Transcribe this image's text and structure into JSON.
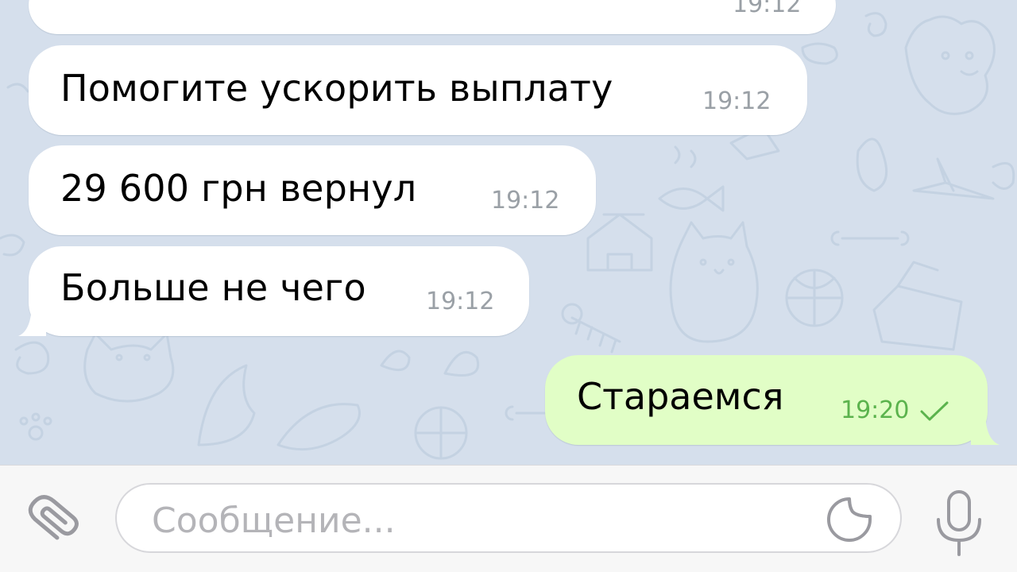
{
  "messages": [
    {
      "direction": "incoming",
      "text": "",
      "time": "19:12"
    },
    {
      "direction": "incoming",
      "text": "Помогите ускорить выплату",
      "time": "19:12"
    },
    {
      "direction": "incoming",
      "text": "29 600 грн вернул",
      "time": "19:12"
    },
    {
      "direction": "incoming",
      "text": "Больше не чего",
      "time": "19:12"
    },
    {
      "direction": "outgoing",
      "text": "Стараемся",
      "time": "19:20",
      "status": "sent-checkmark"
    }
  ],
  "composer": {
    "placeholder": "Сообщение..."
  },
  "icons": {
    "attach": "paperclip-icon",
    "sticker": "sticker-icon",
    "voice": "microphone-icon",
    "sent": "checkmark-icon"
  },
  "colors": {
    "chat_background": "#d5dfec",
    "incoming_bubble": "#ffffff",
    "outgoing_bubble": "#e1fec6",
    "outgoing_time": "#5bb34d",
    "incoming_time": "#9aa0a6",
    "composer_background": "#f7f7f7",
    "icon_gray": "#9a9aa0"
  }
}
